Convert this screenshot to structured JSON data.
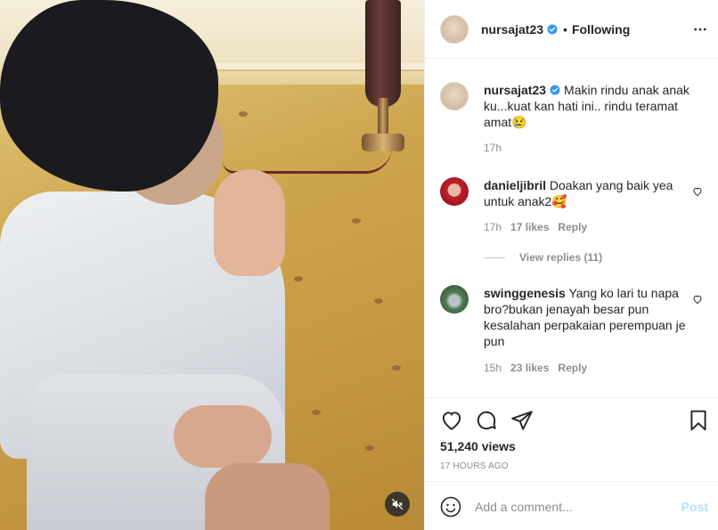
{
  "post": {
    "author": "nursajat23",
    "separator": "•",
    "following_label": "Following",
    "caption_text": "Makin rindu anak anak ku...kuat kan hati ini.. rindu teramat amat😢",
    "caption_time": "17h"
  },
  "comments": [
    {
      "username": "danieljibril",
      "text": "Doakan yang baik yea untuk anak2🥰",
      "time": "17h",
      "likes": "17 likes",
      "reply_label": "Reply",
      "view_replies": "View replies (11)"
    },
    {
      "username": "swinggenesis",
      "text": "Yang ko lari tu napa bro?bukan jenayah besar pun kesalahan perpakaian perempuan je pun",
      "time": "15h",
      "likes": "23 likes",
      "reply_label": "Reply"
    }
  ],
  "stats": {
    "views": "51,240 views",
    "posted": "17 HOURS AGO"
  },
  "add_comment": {
    "placeholder": "Add a comment...",
    "post_label": "Post"
  },
  "icons": [
    "more-options-icon",
    "verified-badge-icon",
    "heart-icon",
    "comment-icon",
    "share-icon",
    "bookmark-icon",
    "emoji-icon",
    "audio-muted-icon"
  ],
  "colors": {
    "verified": "#3897f0",
    "post_disabled": "#b2dffc",
    "secondary_text": "#8e8e8e"
  }
}
